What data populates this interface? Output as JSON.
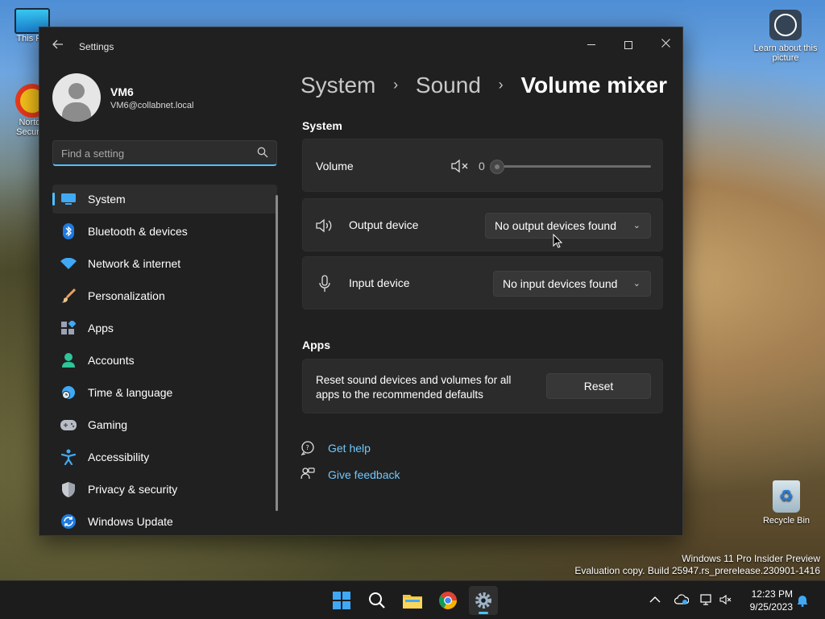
{
  "desktop": {
    "icons": {
      "this_pc": "This PC",
      "norton": "Norton Security",
      "learn": "Learn about this picture",
      "recycle": "Recycle Bin"
    },
    "watermark": {
      "line1": "Windows 11 Pro Insider Preview",
      "line2": "Evaluation copy. Build 25947.rs_prerelease.230901-1416"
    }
  },
  "window": {
    "title": "Settings",
    "controls": {
      "minimize": "minimize-icon",
      "maximize": "maximize-icon",
      "close": "close-icon"
    }
  },
  "profile": {
    "name": "VM6",
    "email": "VM6@collabnet.local"
  },
  "search": {
    "placeholder": "Find a setting",
    "value": ""
  },
  "nav": {
    "items": [
      {
        "label": "System",
        "icon": "system-icon",
        "active": true
      },
      {
        "label": "Bluetooth & devices",
        "icon": "bluetooth-icon"
      },
      {
        "label": "Network & internet",
        "icon": "wifi-icon"
      },
      {
        "label": "Personalization",
        "icon": "brush-icon"
      },
      {
        "label": "Apps",
        "icon": "apps-icon"
      },
      {
        "label": "Accounts",
        "icon": "accounts-icon"
      },
      {
        "label": "Time & language",
        "icon": "globe-clock-icon"
      },
      {
        "label": "Gaming",
        "icon": "gamepad-icon"
      },
      {
        "label": "Accessibility",
        "icon": "accessibility-icon"
      },
      {
        "label": "Privacy & security",
        "icon": "shield-icon"
      },
      {
        "label": "Windows Update",
        "icon": "update-icon"
      }
    ]
  },
  "breadcrumb": {
    "items": [
      "System",
      "Sound"
    ],
    "current": "Volume mixer"
  },
  "system_section": {
    "heading": "System",
    "volume": {
      "label": "Volume",
      "value": "0",
      "muted": true
    },
    "output": {
      "label": "Output device",
      "selected": "No output devices found"
    },
    "input": {
      "label": "Input device",
      "selected": "No input devices found"
    }
  },
  "apps_section": {
    "heading": "Apps",
    "reset_text": "Reset sound devices and volumes for all apps to the recommended defaults",
    "reset_button": "Reset"
  },
  "links": {
    "help": "Get help",
    "feedback": "Give feedback"
  },
  "taskbar": {
    "clock_time": "12:23 PM",
    "clock_date": "9/25/2023",
    "apps": [
      "start-icon",
      "search-icon",
      "file-explorer-icon",
      "chrome-icon",
      "settings-icon"
    ],
    "accent": "#4cc2ff"
  }
}
